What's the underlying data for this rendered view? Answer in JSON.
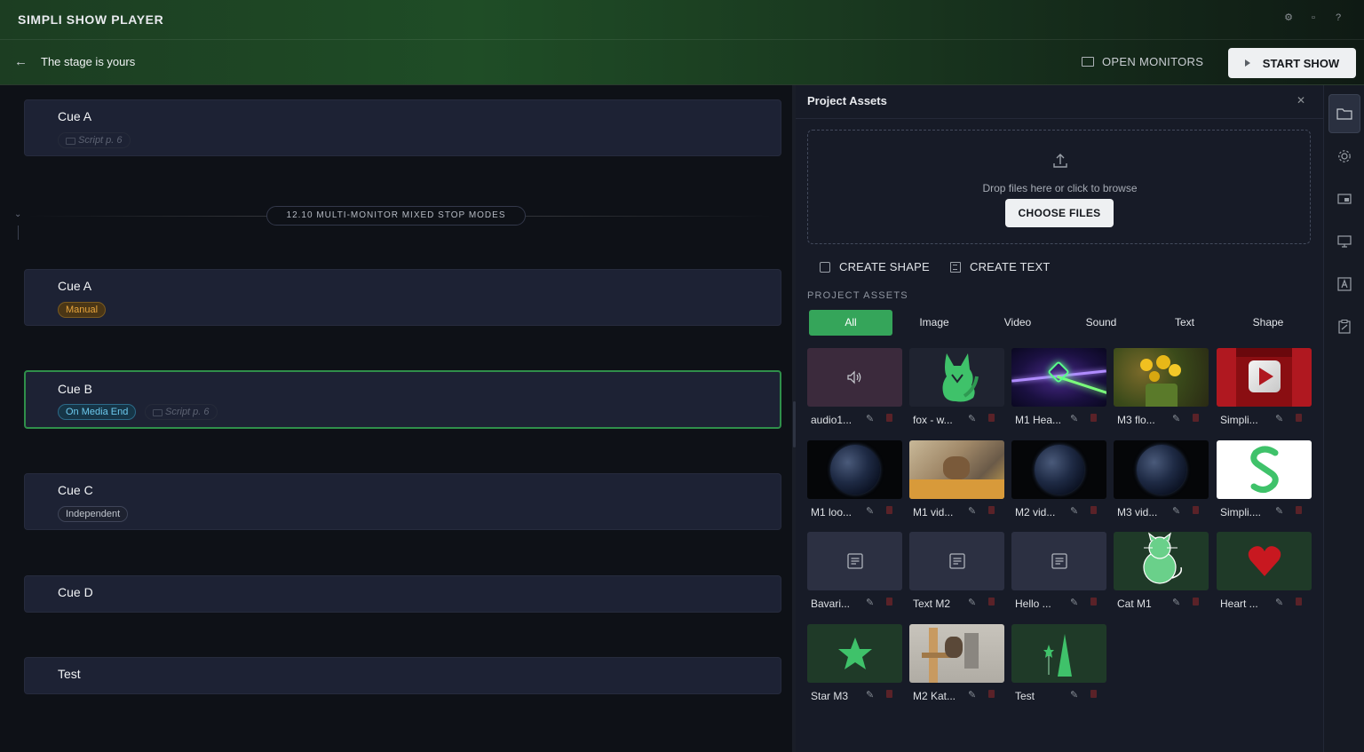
{
  "app": {
    "title": "SIMPLI SHOW PLAYER",
    "show_name": "The stage is yours",
    "open_monitors_label": "OPEN MONITORS",
    "start_show_label": "START SHOW",
    "top_icons": [
      "gear-icon",
      "chat-icon",
      "help-icon"
    ]
  },
  "cue_list": {
    "group": {
      "label": "12.10 MULTI-MONITOR MIXED STOP MODES"
    },
    "cues": [
      {
        "title": "Cue A",
        "script": "Script p. 6"
      },
      {
        "title": "Cue A",
        "badge": "Manual"
      },
      {
        "title": "Cue B",
        "badge": "On Media End",
        "script": "Script p. 6",
        "selected": true
      },
      {
        "title": "Cue C",
        "badge": "Independent"
      },
      {
        "title": "Cue D"
      },
      {
        "title": "Test"
      }
    ]
  },
  "assets": {
    "title": "Project Assets",
    "drop_text": "Drop files here or click to browse",
    "choose_files_label": "CHOOSE FILES",
    "create_shape_label": "CREATE SHAPE",
    "create_text_label": "CREATE TEXT",
    "section_label": "PROJECT ASSETS",
    "filters": [
      "All",
      "Image",
      "Video",
      "Sound",
      "Text",
      "Shape"
    ],
    "active_filter": "All",
    "items": [
      {
        "name": "audio1...",
        "kind": "sound"
      },
      {
        "name": "fox - w...",
        "kind": "fox"
      },
      {
        "name": "M1 Hea...",
        "kind": "neon"
      },
      {
        "name": "M3 flo...",
        "kind": "flowers"
      },
      {
        "name": "Simpli...",
        "kind": "theater"
      },
      {
        "name": "M1 loo...",
        "kind": "earth"
      },
      {
        "name": "M1 vid...",
        "kind": "cat-photo"
      },
      {
        "name": "M2 vid...",
        "kind": "earth"
      },
      {
        "name": "M3 vid...",
        "kind": "earth"
      },
      {
        "name": "Simpli....",
        "kind": "logo"
      },
      {
        "name": "Bavari...",
        "kind": "text"
      },
      {
        "name": "Text M2",
        "kind": "text"
      },
      {
        "name": "Hello ...",
        "kind": "text"
      },
      {
        "name": "Cat M1",
        "kind": "cat-shape"
      },
      {
        "name": "Heart ...",
        "kind": "heart"
      },
      {
        "name": "Star M3",
        "kind": "star"
      },
      {
        "name": "M2 Kat...",
        "kind": "cat-tree"
      },
      {
        "name": "Test",
        "kind": "triangle"
      }
    ]
  },
  "right_rail": [
    "folder-icon",
    "gear-icon",
    "display-icon",
    "monitor-icon",
    "text-box-icon",
    "clipboard-icon"
  ],
  "colors": {
    "accent_green": "#35a55a",
    "selected_border": "#2f8f4a",
    "badge_manual": "#e7a43c",
    "badge_media": "#6cc9ee",
    "card_bg": "#1d2234"
  }
}
